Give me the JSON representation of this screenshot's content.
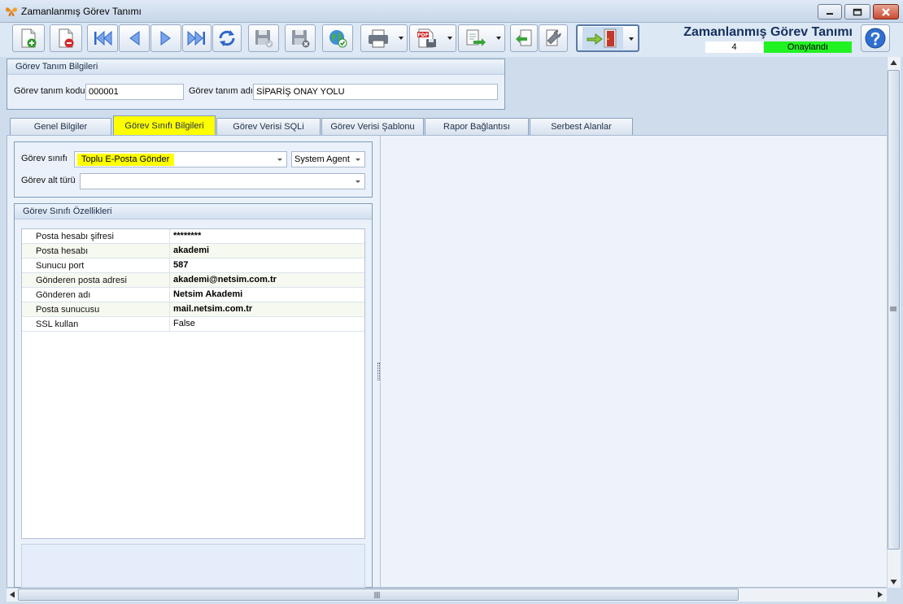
{
  "window": {
    "title": "Zamanlanmış Görev Tanımı"
  },
  "header": {
    "form_title": "Zamanlanmış Görev Tanımı",
    "record_no": "4",
    "status": "Onaylandı"
  },
  "toolbar": {
    "buttons": [
      {
        "name": "new-document-icon"
      },
      {
        "name": "delete-document-icon"
      },
      {
        "name": "first-record-icon"
      },
      {
        "name": "previous-record-icon"
      },
      {
        "name": "next-record-icon"
      },
      {
        "name": "last-record-icon"
      },
      {
        "name": "refresh-icon"
      },
      {
        "name": "save-icon"
      },
      {
        "name": "save-cancel-icon"
      },
      {
        "name": "globe-check-icon"
      },
      {
        "name": "printer-icon"
      },
      {
        "name": "pdf-export-icon"
      },
      {
        "name": "export-icon"
      },
      {
        "name": "import-icon"
      },
      {
        "name": "settings-wrench-icon"
      },
      {
        "name": "exit-door-icon"
      }
    ],
    "pdf_label": "PDF"
  },
  "gorev_tanim": {
    "panel_title": "Görev Tanım Bilgileri",
    "code_label": "Görev tanım kodu",
    "code_value": "000001",
    "name_label": "Görev tanım adı",
    "name_value": "SİPARİŞ ONAY YOLU"
  },
  "tabs": [
    {
      "label": "Genel Bilgiler",
      "active": false
    },
    {
      "label": "Görev Sınıfı Bilgileri",
      "active": true
    },
    {
      "label": "Görev Verisi SQLi",
      "active": false
    },
    {
      "label": "Görev Verisi Şablonu",
      "active": false
    },
    {
      "label": "Rapor Bağlantısı",
      "active": false
    },
    {
      "label": "Serbest Alanlar",
      "active": false
    }
  ],
  "gorev_sinifi": {
    "class_label": "Görev sınıfı",
    "class_value": "Toplu E-Posta Gönder",
    "agent_value": "System Agent",
    "subtype_label": "Görev alt türü",
    "subtype_value": ""
  },
  "ozellikler": {
    "panel_title": "Görev Sınıfı Özellikleri",
    "rows": [
      {
        "name": "Posta hesabı şifresi",
        "value": "********"
      },
      {
        "name": "Posta hesabı",
        "value": "akademi"
      },
      {
        "name": "Sunucu port",
        "value": "587"
      },
      {
        "name": "Gönderen posta adresi",
        "value": "akademi@netsim.com.tr"
      },
      {
        "name": "Gönderen adı",
        "value": "Netsim Akademi"
      },
      {
        "name": "Posta sunucusu",
        "value": "mail.netsim.com.tr"
      },
      {
        "name": "SSL kullan",
        "value": "False"
      }
    ]
  },
  "colors": {
    "highlight": "#ffff00",
    "approved": "#21f221",
    "title_blue": "#15305f"
  }
}
